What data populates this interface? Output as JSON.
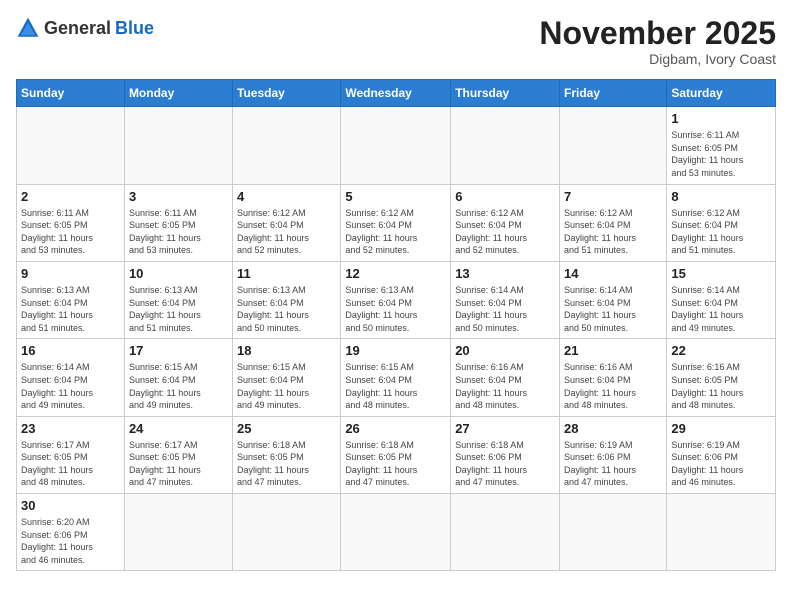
{
  "header": {
    "logo_general": "General",
    "logo_blue": "Blue",
    "month": "November 2025",
    "location": "Digbam, Ivory Coast"
  },
  "weekdays": [
    "Sunday",
    "Monday",
    "Tuesday",
    "Wednesday",
    "Thursday",
    "Friday",
    "Saturday"
  ],
  "days": [
    {
      "num": "",
      "info": ""
    },
    {
      "num": "",
      "info": ""
    },
    {
      "num": "",
      "info": ""
    },
    {
      "num": "",
      "info": ""
    },
    {
      "num": "",
      "info": ""
    },
    {
      "num": "",
      "info": ""
    },
    {
      "num": "1",
      "info": "Sunrise: 6:11 AM\nSunset: 6:05 PM\nDaylight: 11 hours\nand 53 minutes."
    },
    {
      "num": "2",
      "info": "Sunrise: 6:11 AM\nSunset: 6:05 PM\nDaylight: 11 hours\nand 53 minutes."
    },
    {
      "num": "3",
      "info": "Sunrise: 6:11 AM\nSunset: 6:05 PM\nDaylight: 11 hours\nand 53 minutes."
    },
    {
      "num": "4",
      "info": "Sunrise: 6:12 AM\nSunset: 6:04 PM\nDaylight: 11 hours\nand 52 minutes."
    },
    {
      "num": "5",
      "info": "Sunrise: 6:12 AM\nSunset: 6:04 PM\nDaylight: 11 hours\nand 52 minutes."
    },
    {
      "num": "6",
      "info": "Sunrise: 6:12 AM\nSunset: 6:04 PM\nDaylight: 11 hours\nand 52 minutes."
    },
    {
      "num": "7",
      "info": "Sunrise: 6:12 AM\nSunset: 6:04 PM\nDaylight: 11 hours\nand 51 minutes."
    },
    {
      "num": "8",
      "info": "Sunrise: 6:12 AM\nSunset: 6:04 PM\nDaylight: 11 hours\nand 51 minutes."
    },
    {
      "num": "9",
      "info": "Sunrise: 6:13 AM\nSunset: 6:04 PM\nDaylight: 11 hours\nand 51 minutes."
    },
    {
      "num": "10",
      "info": "Sunrise: 6:13 AM\nSunset: 6:04 PM\nDaylight: 11 hours\nand 51 minutes."
    },
    {
      "num": "11",
      "info": "Sunrise: 6:13 AM\nSunset: 6:04 PM\nDaylight: 11 hours\nand 50 minutes."
    },
    {
      "num": "12",
      "info": "Sunrise: 6:13 AM\nSunset: 6:04 PM\nDaylight: 11 hours\nand 50 minutes."
    },
    {
      "num": "13",
      "info": "Sunrise: 6:14 AM\nSunset: 6:04 PM\nDaylight: 11 hours\nand 50 minutes."
    },
    {
      "num": "14",
      "info": "Sunrise: 6:14 AM\nSunset: 6:04 PM\nDaylight: 11 hours\nand 50 minutes."
    },
    {
      "num": "15",
      "info": "Sunrise: 6:14 AM\nSunset: 6:04 PM\nDaylight: 11 hours\nand 49 minutes."
    },
    {
      "num": "16",
      "info": "Sunrise: 6:14 AM\nSunset: 6:04 PM\nDaylight: 11 hours\nand 49 minutes."
    },
    {
      "num": "17",
      "info": "Sunrise: 6:15 AM\nSunset: 6:04 PM\nDaylight: 11 hours\nand 49 minutes."
    },
    {
      "num": "18",
      "info": "Sunrise: 6:15 AM\nSunset: 6:04 PM\nDaylight: 11 hours\nand 49 minutes."
    },
    {
      "num": "19",
      "info": "Sunrise: 6:15 AM\nSunset: 6:04 PM\nDaylight: 11 hours\nand 48 minutes."
    },
    {
      "num": "20",
      "info": "Sunrise: 6:16 AM\nSunset: 6:04 PM\nDaylight: 11 hours\nand 48 minutes."
    },
    {
      "num": "21",
      "info": "Sunrise: 6:16 AM\nSunset: 6:04 PM\nDaylight: 11 hours\nand 48 minutes."
    },
    {
      "num": "22",
      "info": "Sunrise: 6:16 AM\nSunset: 6:05 PM\nDaylight: 11 hours\nand 48 minutes."
    },
    {
      "num": "23",
      "info": "Sunrise: 6:17 AM\nSunset: 6:05 PM\nDaylight: 11 hours\nand 48 minutes."
    },
    {
      "num": "24",
      "info": "Sunrise: 6:17 AM\nSunset: 6:05 PM\nDaylight: 11 hours\nand 47 minutes."
    },
    {
      "num": "25",
      "info": "Sunrise: 6:18 AM\nSunset: 6:05 PM\nDaylight: 11 hours\nand 47 minutes."
    },
    {
      "num": "26",
      "info": "Sunrise: 6:18 AM\nSunset: 6:05 PM\nDaylight: 11 hours\nand 47 minutes."
    },
    {
      "num": "27",
      "info": "Sunrise: 6:18 AM\nSunset: 6:06 PM\nDaylight: 11 hours\nand 47 minutes."
    },
    {
      "num": "28",
      "info": "Sunrise: 6:19 AM\nSunset: 6:06 PM\nDaylight: 11 hours\nand 47 minutes."
    },
    {
      "num": "29",
      "info": "Sunrise: 6:19 AM\nSunset: 6:06 PM\nDaylight: 11 hours\nand 46 minutes."
    },
    {
      "num": "30",
      "info": "Sunrise: 6:20 AM\nSunset: 6:06 PM\nDaylight: 11 hours\nand 46 minutes."
    }
  ]
}
